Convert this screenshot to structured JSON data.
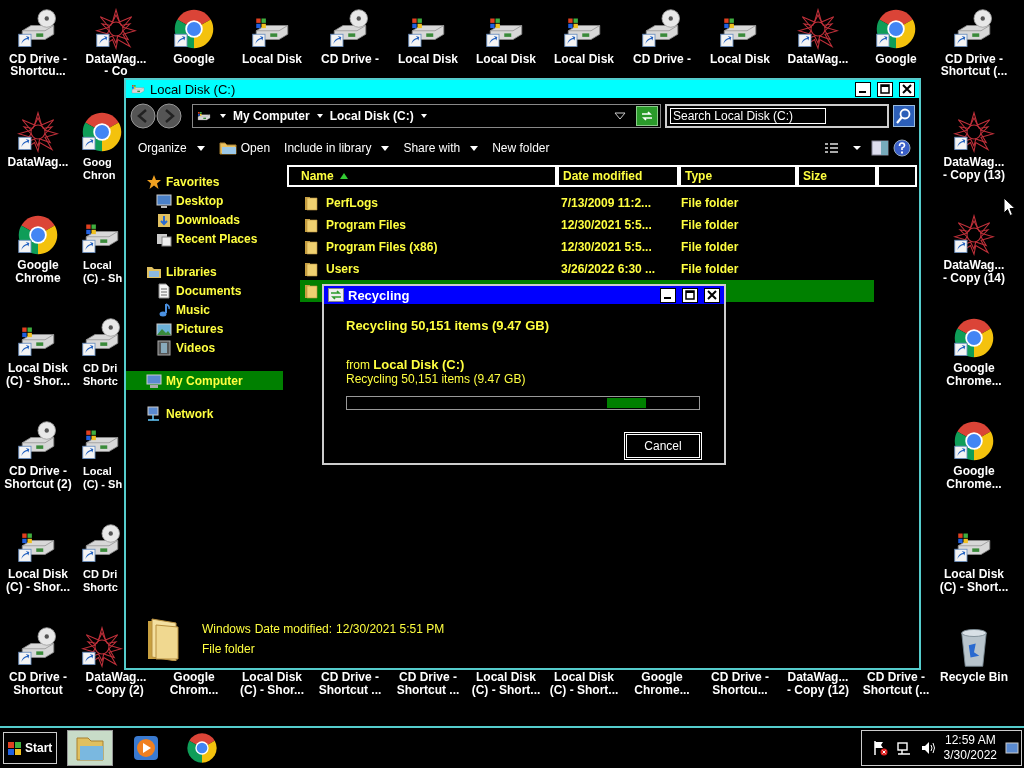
{
  "desktop": {
    "rows": [
      [
        {
          "kind": "cd",
          "label": [
            "CD Drive -",
            "Shortcu..."
          ],
          "shortcut": true
        },
        {
          "kind": "datawag",
          "label": [
            "DataWag...",
            "- Co"
          ],
          "shortcut": true
        },
        {
          "kind": "chrome",
          "label": [
            "Google"
          ],
          "shortcut": true
        },
        {
          "kind": "disk",
          "label": [
            "Local Disk"
          ],
          "shortcut": true
        },
        {
          "kind": "cd",
          "label": [
            "CD Drive -"
          ],
          "shortcut": true
        },
        {
          "kind": "disk",
          "label": [
            "Local Disk"
          ],
          "shortcut": true
        },
        {
          "kind": "disk",
          "label": [
            "Local Disk"
          ],
          "shortcut": true
        },
        {
          "kind": "disk",
          "label": [
            "Local Disk"
          ],
          "shortcut": true
        },
        {
          "kind": "cd",
          "label": [
            "CD Drive -"
          ],
          "shortcut": true
        },
        {
          "kind": "disk",
          "label": [
            "Local Disk"
          ],
          "shortcut": true
        },
        {
          "kind": "datawag",
          "label": [
            "DataWag..."
          ],
          "shortcut": true
        },
        {
          "kind": "chrome",
          "label": [
            "Google"
          ],
          "shortcut": true
        },
        {
          "kind": "cd",
          "label": [
            "CD Drive -",
            "Shortcut (..."
          ],
          "shortcut": true
        }
      ],
      [
        {
          "kind": "datawag",
          "label": [
            "DataWag..."
          ],
          "shortcut": true
        },
        {
          "kind": "chrome",
          "label": [
            "Goog",
            "Chron"
          ],
          "shortcut": true
        },
        {
          "kind": "datawag",
          "label": [
            "DataWag...",
            "- Copy (13)"
          ],
          "shortcut": true
        }
      ],
      [
        {
          "kind": "chrome",
          "label": [
            "Google",
            "Chrome"
          ],
          "shortcut": true
        },
        {
          "kind": "disk",
          "label": [
            "Local",
            "(C) - Sh"
          ],
          "shortcut": true
        },
        {
          "kind": "datawag",
          "label": [
            "DataWag...",
            "- Copy (14)"
          ],
          "shortcut": true
        }
      ],
      [
        {
          "kind": "disk",
          "label": [
            "Local Disk",
            "(C) - Shor..."
          ],
          "shortcut": true
        },
        {
          "kind": "cd",
          "label": [
            "CD Dri",
            "Shortc"
          ],
          "shortcut": true
        },
        {
          "kind": "chrome",
          "label": [
            "Google",
            "Chrome..."
          ],
          "shortcut": true
        }
      ],
      [
        {
          "kind": "cd",
          "label": [
            "CD Drive -",
            "Shortcut (2)"
          ],
          "shortcut": true
        },
        {
          "kind": "disk",
          "label": [
            "Local",
            "(C) - Sh"
          ],
          "shortcut": true
        },
        {
          "kind": "chrome",
          "label": [
            "Google",
            "Chrome..."
          ],
          "shortcut": true
        }
      ],
      [
        {
          "kind": "disk",
          "label": [
            "Local Disk",
            "(C) - Shor..."
          ],
          "shortcut": true
        },
        {
          "kind": "cd",
          "label": [
            "CD Dri",
            "Shortc"
          ],
          "shortcut": true
        },
        {
          "kind": "disk",
          "label": [
            "Local Disk",
            "(C) - Short..."
          ],
          "shortcut": true
        }
      ],
      [
        {
          "kind": "cd",
          "label": [
            "CD Drive -",
            "Shortcut"
          ],
          "shortcut": true
        },
        {
          "kind": "datawag",
          "label": [
            "DataWag...",
            "- Copy (2)"
          ],
          "shortcut": true
        },
        {
          "label": [
            "Google",
            "Chrom..."
          ]
        },
        {
          "label": [
            "Local Disk",
            "(C) - Shor..."
          ]
        },
        {
          "label": [
            "CD Drive -",
            "Shortcut ..."
          ]
        },
        {
          "label": [
            "CD Drive -",
            "Shortcut ..."
          ]
        },
        {
          "label": [
            "Local Disk",
            "(C) - Short..."
          ]
        },
        {
          "label": [
            "Local Disk",
            "(C) - Short..."
          ]
        },
        {
          "label": [
            "Google",
            "Chrome..."
          ]
        },
        {
          "label": [
            "CD Drive -",
            "Shortcu..."
          ]
        },
        {
          "label": [
            "DataWag...",
            "- Copy (12)"
          ]
        },
        {
          "label": [
            "CD Drive -",
            "Shortcut (..."
          ]
        },
        {
          "kind": "recycle",
          "label": [
            "Recycle Bin"
          ],
          "shortcut": false
        }
      ]
    ]
  },
  "window": {
    "title": "Local Disk (C:)",
    "breadcrumbs": [
      "My Computer",
      "Local Disk (C:)"
    ],
    "search": {
      "placeholder": "Search Local Disk (C:)"
    },
    "toolbar": [
      {
        "label": "Organize",
        "kind": "menu"
      },
      {
        "label": "Open",
        "kind": "open"
      },
      {
        "label": "Include in library",
        "kind": "menu"
      },
      {
        "label": "Share with",
        "kind": "menu"
      },
      {
        "label": "New folder",
        "kind": "command"
      }
    ],
    "navigation": [
      {
        "label": "Favorites",
        "kind": "star",
        "selected": false,
        "children": [
          {
            "label": "Desktop",
            "kind": "desktop",
            "selected": false
          },
          {
            "label": "Downloads",
            "kind": "downloads",
            "selected": false
          },
          {
            "label": "Recent Places",
            "kind": "recent",
            "selected": false
          }
        ]
      },
      {
        "label": "Libraries",
        "kind": "library",
        "selected": false,
        "children": [
          {
            "label": "Documents",
            "kind": "document",
            "selected": false
          },
          {
            "label": "Music",
            "kind": "music",
            "selected": false
          },
          {
            "label": "Pictures",
            "kind": "picture",
            "selected": false
          },
          {
            "label": "Videos",
            "kind": "video",
            "selected": false
          }
        ]
      },
      {
        "label": "My Computer",
        "kind": "computer",
        "selected": true
      },
      {
        "label": "Network",
        "kind": "network",
        "selected": false
      }
    ],
    "columns": [
      {
        "label": "Name",
        "sorted": true
      },
      {
        "label": "Date modified",
        "sorted": false
      },
      {
        "label": "Type",
        "sorted": false
      },
      {
        "label": "Size",
        "sorted": false
      }
    ],
    "rows": [
      {
        "name": "PerfLogs",
        "date": "7/13/2009 11:2...",
        "type": "File folder",
        "selected": false
      },
      {
        "name": "Program Files",
        "date": "12/30/2021 5:5...",
        "type": "File folder",
        "selected": false
      },
      {
        "name": "Program Files (x86)",
        "date": "12/30/2021 5:5...",
        "type": "File folder",
        "selected": false
      },
      {
        "name": "Users",
        "date": "3/26/2022 6:30 ...",
        "type": "File folder",
        "selected": false
      },
      {
        "selected": true
      }
    ],
    "details": {
      "name": "Windows",
      "date_label": "Date modified:",
      "date": "12/30/2021 5:51 PM",
      "type": "File folder"
    }
  },
  "dialog": {
    "title": "Recycling",
    "heading": "Recycling 50,151 items (9.47 GB)",
    "from": "from **Local Disk (C:)**",
    "detail": "Recycling 50,151 items (9.47 GB)",
    "progress": {
      "level": 0.85
    },
    "button": "Cancel"
  },
  "taskbar": {
    "start": "Start",
    "apps": [
      {
        "kind": "explorer",
        "selected": true
      },
      {
        "kind": "media",
        "selected": false
      },
      {
        "kind": "chrome",
        "selected": false
      }
    ],
    "time": "12:59 AM",
    "date": "3/30/2022"
  }
}
